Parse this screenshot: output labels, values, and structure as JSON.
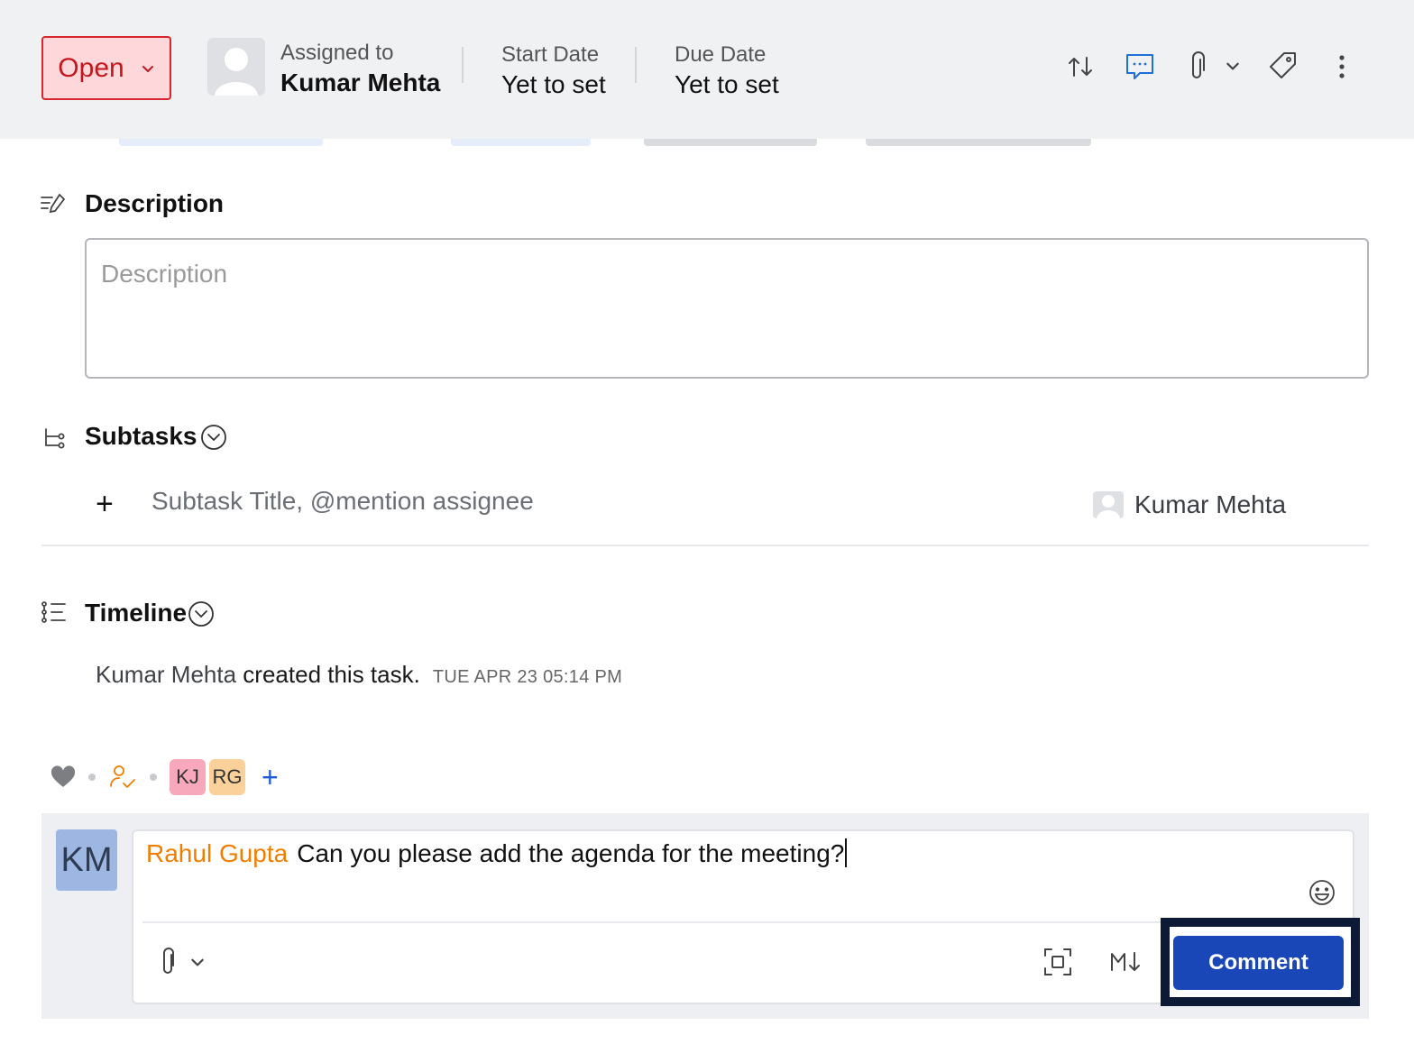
{
  "header": {
    "status_label": "Open",
    "assigned_label": "Assigned to",
    "assignee_name": "Kumar Mehta",
    "start_label": "Start Date",
    "start_value": "Yet to set",
    "due_label": "Due Date",
    "due_value": "Yet to set",
    "icons": [
      "repeat-icon",
      "comment-icon",
      "attachment-icon",
      "chevron-down-icon",
      "tag-icon",
      "more-vertical-icon"
    ]
  },
  "description": {
    "title": "Description",
    "placeholder": "Description"
  },
  "subtasks": {
    "title": "Subtasks",
    "input_placeholder": "Subtask Title, @mention assignee",
    "assignee_name": "Kumar Mehta"
  },
  "timeline": {
    "title": "Timeline",
    "entries": [
      {
        "actor": "Kumar Mehta",
        "action": " created this task.",
        "timestamp": "TUE APR 23 05:14 PM"
      }
    ]
  },
  "reactions": {
    "followers": [
      "KJ",
      "RG"
    ],
    "follower_colors": [
      "#f7a9bb",
      "#fbd19b"
    ]
  },
  "comment": {
    "user_initials": "KM",
    "mention": "Rahul Gupta",
    "text": "Can you please add the agenda for the meeting?",
    "submit_label": "Comment"
  },
  "colors": {
    "status_bg": "#fdd7da",
    "status_text": "#c4161d",
    "mention": "#f07e00",
    "primary": "#1a47b8"
  }
}
